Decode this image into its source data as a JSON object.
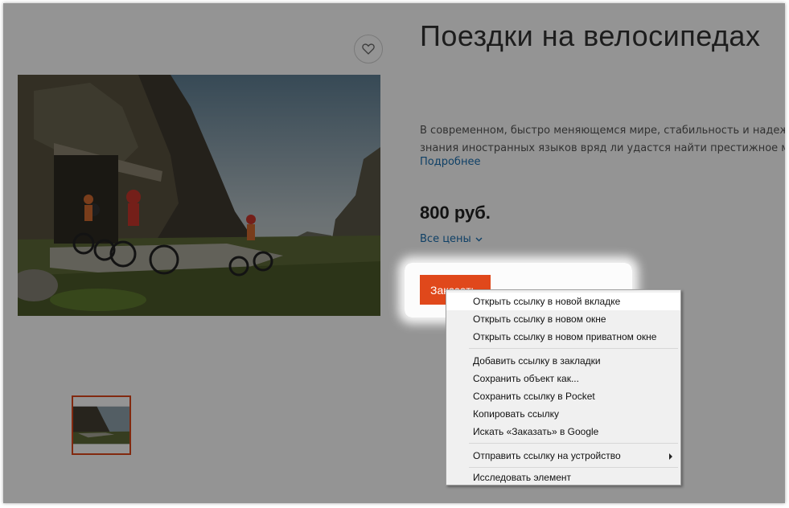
{
  "product": {
    "title": "Поездки на велосипедах",
    "description_line1": "В современном, быстро меняющемся мире, стабильность и надежност",
    "description_line2": "знания иностранных языков вряд ли удастся найти престижное место р",
    "more_link": "Подробнее",
    "price": "800 руб.",
    "all_prices_link": "Все цены",
    "order_button": "Заказать"
  },
  "context_menu": {
    "items": [
      "Открыть ссылку в новой вкладке",
      "Открыть ссылку в новом окне",
      "Открыть ссылку в новом приватном окне",
      "Добавить ссылку в закладки",
      "Сохранить объект как...",
      "Сохранить ссылку в Pocket",
      "Копировать ссылку",
      "Искать «Заказать» в Google",
      "Отправить ссылку на устройство",
      "Исследовать элемент"
    ],
    "highlighted_index": 0,
    "submenu_index": 8
  },
  "icons": {
    "favorite": "heart-icon",
    "dropdown": "chevron-down-icon",
    "submenu": "submenu-arrow-icon"
  },
  "colors": {
    "accent": "#e0481b",
    "link": "#1a6fb0",
    "overlay": "rgba(0,0,0,0.42)",
    "menu_background": "#f0f0f0"
  }
}
